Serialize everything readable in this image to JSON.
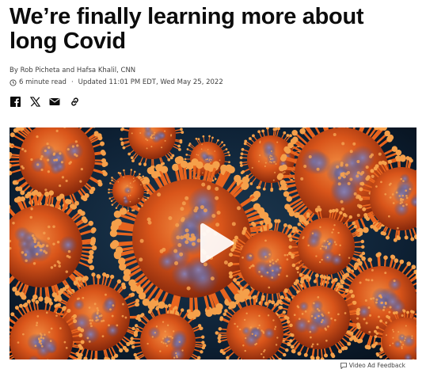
{
  "article": {
    "headline": "We’re finally learning more about long Covid",
    "byline": "By Rob Picheta and Hafsa Khalil, CNN",
    "read_time": "6 minute read",
    "updated": "Updated 11:01 PM EDT, Wed May 25, 2022"
  },
  "share_icons": [
    "facebook-icon",
    "x-icon",
    "email-icon",
    "link-icon"
  ],
  "video": {
    "feedback_label": "Video Ad Feedback"
  },
  "colors": {
    "headline": "#0c0c0c",
    "meta": "#404040",
    "virus_orange": "#e8641e",
    "virus_background": "#0a1a2a"
  }
}
